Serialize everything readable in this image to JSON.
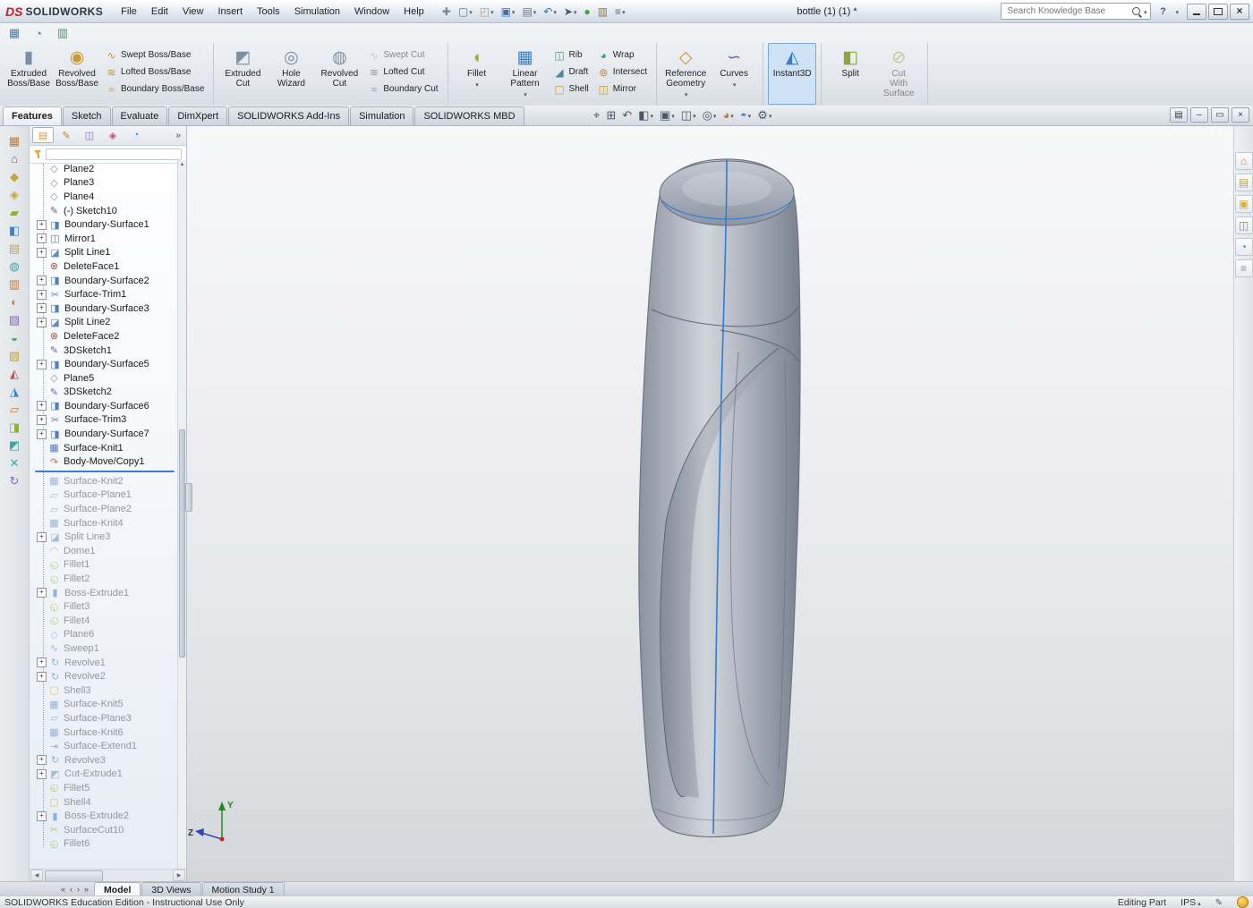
{
  "window": {
    "brand": "SOLIDWORKS",
    "brand_mark": "DS",
    "title": "bottle (1) (1) *",
    "search_placeholder": "Search Knowledge Base"
  },
  "accent": {
    "split_line_blue": "#2e7cd6",
    "rollback_blue": "#3a7bd5",
    "instant3d_highlight": "#cfe3f6"
  },
  "menubar": {
    "menus": [
      "File",
      "Edit",
      "View",
      "Insert",
      "Tools",
      "Simulation",
      "Window",
      "Help"
    ],
    "quick_tools": [
      {
        "name": "pin-button",
        "glyph": "✚",
        "color": "#7a8594"
      },
      {
        "name": "new-document-button",
        "glyph": "▢",
        "color": "#5a7a9a",
        "dropdown": true
      },
      {
        "name": "open-button",
        "glyph": "◰",
        "color": "#c8a23a",
        "dropdown": true
      },
      {
        "name": "save-button",
        "glyph": "▣",
        "color": "#3a6fb0",
        "dropdown": true
      },
      {
        "name": "print-button",
        "glyph": "▤",
        "color": "#6a7684",
        "dropdown": true
      },
      {
        "name": "undo-button",
        "glyph": "↶",
        "color": "#3a6fb0",
        "dropdown": true
      },
      {
        "name": "select-button",
        "glyph": "➤",
        "color": "#4a5560",
        "dropdown": true
      },
      {
        "name": "rebuild-button",
        "glyph": "●",
        "color": "#3aa04a"
      },
      {
        "name": "file-properties-button",
        "glyph": "▥",
        "color": "#8a7a4a"
      },
      {
        "name": "options-button",
        "glyph": "≡",
        "color": "#5a6672",
        "dropdown": true
      }
    ]
  },
  "ribbon": {
    "mini_tools": [
      {
        "name": "mini-tool-1",
        "glyph": "▦",
        "color": "#5a7a9a"
      },
      {
        "name": "mini-tool-2",
        "glyph": "◔",
        "color": "#3a86c8"
      },
      {
        "name": "mini-tool-3",
        "glyph": "▥",
        "color": "#5a8a6a"
      }
    ],
    "tabs": [
      {
        "label": "Features",
        "active": true
      },
      {
        "label": "Sketch"
      },
      {
        "label": "Evaluate"
      },
      {
        "label": "DimXpert"
      },
      {
        "label": "SOLIDWORKS Add-Ins"
      },
      {
        "label": "Simulation"
      },
      {
        "label": "SOLIDWORKS MBD"
      }
    ],
    "groups": [
      {
        "big": [
          {
            "name": "extruded-boss-base-button",
            "label": "Extruded\nBoss/Base",
            "glyph": "▮",
            "color": "#7d8fa5"
          },
          {
            "name": "revolved-boss-base-button",
            "label": "Revolved\nBoss/Base",
            "glyph": "◉",
            "color": "#c89a30"
          }
        ],
        "smallcols": [
          [
            {
              "name": "swept-boss-base-button",
              "label": "Swept Boss/Base",
              "glyph": "∿",
              "color": "#c89a30"
            },
            {
              "name": "lofted-boss-base-button",
              "label": "Lofted Boss/Base",
              "glyph": "≋",
              "color": "#c89a30"
            },
            {
              "name": "boundary-boss-base-button",
              "label": "Boundary Boss/Base",
              "glyph": "≈",
              "color": "#c89a30"
            }
          ]
        ]
      },
      {
        "big": [
          {
            "name": "extruded-cut-button",
            "label": "Extruded\nCut",
            "glyph": "◩",
            "color": "#7d8fa5"
          },
          {
            "name": "hole-wizard-button",
            "label": "Hole\nWizard",
            "glyph": "◎",
            "color": "#7d8fa5"
          },
          {
            "name": "revolved-cut-button",
            "label": "Revolved\nCut",
            "glyph": "◍",
            "color": "#7d8fa5"
          }
        ],
        "smallcols": [
          [
            {
              "name": "swept-cut-button",
              "label": "Swept Cut",
              "glyph": "∿",
              "color": "#9aa2ac",
              "disabled": true
            },
            {
              "name": "lofted-cut-button",
              "label": "Lofted Cut",
              "glyph": "≋",
              "color": "#8a96a4"
            },
            {
              "name": "boundary-cut-button",
              "label": "Boundary Cut",
              "glyph": "≈",
              "color": "#8a96a4"
            }
          ]
        ]
      },
      {
        "big": [
          {
            "name": "fillet-button",
            "label": "Fillet",
            "glyph": "◖",
            "color": "#9ab33a",
            "dropdown": true
          },
          {
            "name": "linear-pattern-button",
            "label": "Linear\nPattern",
            "glyph": "▦",
            "color": "#3a7fc0",
            "dropdown": true
          }
        ],
        "smallcols": [
          [
            {
              "name": "rib-button",
              "label": "Rib",
              "glyph": "◫",
              "color": "#4a9a6a"
            },
            {
              "name": "draft-button",
              "label": "Draft",
              "glyph": "◢",
              "color": "#4a8aa0"
            },
            {
              "name": "shell-button",
              "label": "Shell",
              "glyph": "▢",
              "color": "#c89a30"
            }
          ],
          [
            {
              "name": "wrap-button",
              "label": "Wrap",
              "glyph": "◕",
              "color": "#3a9a8a"
            },
            {
              "name": "intersect-button",
              "label": "Intersect",
              "glyph": "⊚",
              "color": "#c87a2a"
            },
            {
              "name": "mirror-button",
              "label": "Mirror",
              "glyph": "◫",
              "color": "#c89a30"
            }
          ]
        ]
      },
      {
        "big": [
          {
            "name": "reference-geometry-button",
            "label": "Reference\nGeometry",
            "glyph": "◇",
            "color": "#c89a30",
            "dropdown": true
          },
          {
            "name": "curves-button",
            "label": "Curves",
            "glyph": "∽",
            "color": "#7a5ab0",
            "dropdown": true
          }
        ]
      },
      {
        "big": [
          {
            "name": "instant3d-button",
            "label": "Instant3D",
            "glyph": "◭",
            "color": "#3a7fc0",
            "active": true
          }
        ]
      },
      {
        "big": [
          {
            "name": "split-button",
            "label": "Split",
            "glyph": "◧",
            "color": "#8aa832"
          },
          {
            "name": "cut-with-surface-button",
            "label": "Cut\nWith\nSurface",
            "glyph": "⊘",
            "color": "#8aa832",
            "disabled": true
          }
        ]
      }
    ]
  },
  "headsup": {
    "buttons": [
      {
        "name": "zoom-to-fit-button",
        "glyph": "⌖",
        "color": "#4a5868"
      },
      {
        "name": "zoom-to-area-button",
        "glyph": "⊞",
        "color": "#4a5868"
      },
      {
        "name": "previous-view-button",
        "glyph": "↶",
        "color": "#4a5868"
      },
      {
        "name": "section-view-button",
        "glyph": "◧",
        "color": "#4a5868",
        "dropdown": true
      },
      {
        "name": "view-orientation-button",
        "glyph": "▣",
        "color": "#4a5868",
        "dropdown": true
      },
      {
        "name": "display-style-button",
        "glyph": "◫",
        "color": "#4a5868",
        "dropdown": true
      },
      {
        "name": "hide-show-items-button",
        "glyph": "◎",
        "color": "#4a5868",
        "dropdown": true
      },
      {
        "name": "edit-appearance-button",
        "glyph": "◕",
        "color": "#c87a2a",
        "dropdown": true
      },
      {
        "name": "apply-scene-button",
        "glyph": "◓",
        "color": "#3a86c8",
        "dropdown": true
      },
      {
        "name": "view-settings-button",
        "glyph": "⚙",
        "color": "#4a5868",
        "dropdown": true
      }
    ]
  },
  "docwin_controls": [
    {
      "name": "doc-menu-button",
      "glyph": "▤"
    },
    {
      "name": "doc-minimize-button",
      "glyph": "–"
    },
    {
      "name": "doc-restore-button",
      "glyph": "▭"
    },
    {
      "name": "doc-close-button",
      "glyph": "×"
    }
  ],
  "side_toolbar": [
    {
      "name": "side-tool-1",
      "glyph": "▦",
      "color": "#c87a2a"
    },
    {
      "name": "side-tool-2",
      "glyph": "⌂",
      "color": "#b05030"
    },
    {
      "name": "side-tool-3",
      "glyph": "◆",
      "color": "#c8a23a"
    },
    {
      "name": "side-tool-4",
      "glyph": "◈",
      "color": "#c8a23a"
    },
    {
      "name": "side-tool-5",
      "glyph": "▰",
      "color": "#8fae3a"
    },
    {
      "name": "side-tool-6",
      "glyph": "◧",
      "color": "#3a86c8"
    },
    {
      "name": "side-tool-7",
      "glyph": "▤",
      "color": "#c8a23a"
    },
    {
      "name": "side-tool-8",
      "glyph": "◍",
      "color": "#3aa6a0"
    },
    {
      "name": "side-tool-9",
      "glyph": "▥",
      "color": "#c87a2a"
    },
    {
      "name": "side-tool-10",
      "glyph": "◐",
      "color": "#b08848"
    },
    {
      "name": "side-tool-11",
      "glyph": "▨",
      "color": "#8868b8"
    },
    {
      "name": "side-tool-12",
      "glyph": "◒",
      "color": "#4a9858"
    },
    {
      "name": "side-tool-13",
      "glyph": "▧",
      "color": "#c8a23a"
    },
    {
      "name": "side-tool-14",
      "glyph": "◭",
      "color": "#c85050"
    },
    {
      "name": "side-tool-15",
      "glyph": "◮",
      "color": "#3a86c8"
    },
    {
      "name": "side-tool-16",
      "glyph": "▱",
      "color": "#c87a2a"
    },
    {
      "name": "side-tool-17",
      "glyph": "◨",
      "color": "#8fae3a"
    },
    {
      "name": "side-tool-18",
      "glyph": "◩",
      "color": "#3aa6a0"
    },
    {
      "name": "side-tool-19",
      "glyph": "✕",
      "color": "#3aa6a0"
    },
    {
      "name": "side-tool-20",
      "glyph": "↻",
      "color": "#8868b8"
    }
  ],
  "tree": {
    "tabs": [
      {
        "name": "featuremanager-tab",
        "glyph": "▤",
        "color": "#c8a23a",
        "active": true
      },
      {
        "name": "propertymanager-tab",
        "glyph": "✎",
        "color": "#c87a2a"
      },
      {
        "name": "configurationmanager-tab",
        "glyph": "◫",
        "color": "#8868b8"
      },
      {
        "name": "dimxpertmanager-tab",
        "glyph": "◈",
        "color": "#c85078"
      },
      {
        "name": "displaymanager-tab",
        "glyph": "◔",
        "color": "#3a86c8"
      }
    ],
    "icon_types": {
      "plane": {
        "glyph": "◇",
        "color": "#6f9cc4"
      },
      "sketch": {
        "glyph": "✎",
        "color": "#5f6e80"
      },
      "sketch3d": {
        "glyph": "✎",
        "color": "#7a5ab0"
      },
      "boundary-surface": {
        "glyph": "◨",
        "color": "#4d7fbe"
      },
      "mirror": {
        "glyph": "◫",
        "color": "#4d7fbe"
      },
      "split-line": {
        "glyph": "◪",
        "color": "#5f8cc0"
      },
      "delete-face": {
        "glyph": "⊗",
        "color": "#b05050"
      },
      "surface-trim": {
        "glyph": "✂",
        "color": "#4d7fbe"
      },
      "surface-knit": {
        "glyph": "▦",
        "color": "#4d7fbe"
      },
      "body-move": {
        "glyph": "↷",
        "color": "#c07a2a"
      },
      "surface-plane": {
        "glyph": "▱",
        "color": "#4d7fbe"
      },
      "dome": {
        "glyph": "◠",
        "color": "#c07a2a"
      },
      "fillet": {
        "glyph": "◵",
        "color": "#8aa832"
      },
      "boss-extrude": {
        "glyph": "▮",
        "color": "#3f7fc0"
      },
      "sweep": {
        "glyph": "∿",
        "color": "#3f7fc0"
      },
      "revolve": {
        "glyph": "↻",
        "color": "#3f7fc0"
      },
      "shell": {
        "glyph": "▢",
        "color": "#c89a30"
      },
      "surface-extend": {
        "glyph": "⇥",
        "color": "#4d7fbe"
      },
      "cut-extrude": {
        "glyph": "◩",
        "color": "#7d8fa5"
      },
      "surface-cut": {
        "glyph": "✂",
        "color": "#8aa832"
      }
    },
    "items": [
      {
        "label": "Plane2",
        "type": "plane"
      },
      {
        "label": "Plane3",
        "type": "plane"
      },
      {
        "label": "Plane4",
        "type": "plane"
      },
      {
        "label": "(-) Sketch10",
        "type": "sketch"
      },
      {
        "label": "Boundary-Surface1",
        "type": "boundary-surface",
        "plus": true
      },
      {
        "label": "Mirror1",
        "type": "mirror",
        "plus": true
      },
      {
        "label": "Split Line1",
        "type": "split-line",
        "plus": true
      },
      {
        "label": "DeleteFace1",
        "type": "delete-face"
      },
      {
        "label": "Boundary-Surface2",
        "type": "boundary-surface",
        "plus": true
      },
      {
        "label": "Surface-Trim1",
        "type": "surface-trim",
        "plus": true
      },
      {
        "label": "Boundary-Surface3",
        "type": "boundary-surface",
        "plus": true
      },
      {
        "label": "Split Line2",
        "type": "split-line",
        "plus": true
      },
      {
        "label": "DeleteFace2",
        "type": "delete-face"
      },
      {
        "label": "3DSketch1",
        "type": "sketch3d"
      },
      {
        "label": "Boundary-Surface5",
        "type": "boundary-surface",
        "plus": true
      },
      {
        "label": "Plane5",
        "type": "plane"
      },
      {
        "label": "3DSketch2",
        "type": "sketch3d"
      },
      {
        "label": "Boundary-Surface6",
        "type": "boundary-surface",
        "plus": true
      },
      {
        "label": "Surface-Trim3",
        "type": "surface-trim",
        "plus": true
      },
      {
        "label": "Boundary-Surface7",
        "type": "boundary-surface",
        "plus": true
      },
      {
        "label": "Surface-Knit1",
        "type": "surface-knit"
      },
      {
        "label": "Body-Move/Copy1",
        "type": "body-move",
        "rollback_after": true
      },
      {
        "label": "Surface-Knit2",
        "type": "surface-knit",
        "grayed": true
      },
      {
        "label": "Surface-Plane1",
        "type": "surface-plane",
        "grayed": true
      },
      {
        "label": "Surface-Plane2",
        "type": "surface-plane",
        "grayed": true
      },
      {
        "label": "Surface-Knit4",
        "type": "surface-knit",
        "grayed": true
      },
      {
        "label": "Split Line3",
        "type": "split-line",
        "plus": true,
        "grayed": true
      },
      {
        "label": "Dome1",
        "type": "dome",
        "grayed": true
      },
      {
        "label": "Fillet1",
        "type": "fillet",
        "grayed": true
      },
      {
        "label": "Fillet2",
        "type": "fillet",
        "grayed": true
      },
      {
        "label": "Boss-Extrude1",
        "type": "boss-extrude",
        "plus": true,
        "grayed": true
      },
      {
        "label": "Fillet3",
        "type": "fillet",
        "grayed": true
      },
      {
        "label": "Fillet4",
        "type": "fillet",
        "grayed": true
      },
      {
        "label": "Plane6",
        "type": "plane",
        "grayed": true
      },
      {
        "label": "Sweep1",
        "type": "sweep",
        "grayed": true
      },
      {
        "label": "Revolve1",
        "type": "revolve",
        "plus": true,
        "grayed": true
      },
      {
        "label": "Revolve2",
        "type": "revolve",
        "plus": true,
        "grayed": true
      },
      {
        "label": "Shell3",
        "type": "shell",
        "grayed": true
      },
      {
        "label": "Surface-Knit5",
        "type": "surface-knit",
        "grayed": true
      },
      {
        "label": "Surface-Plane3",
        "type": "surface-plane",
        "grayed": true
      },
      {
        "label": "Surface-Knit6",
        "type": "surface-knit",
        "grayed": true
      },
      {
        "label": "Surface-Extend1",
        "type": "surface-extend",
        "grayed": true
      },
      {
        "label": "Revolve3",
        "type": "revolve",
        "plus": true,
        "grayed": true
      },
      {
        "label": "Cut-Extrude1",
        "type": "cut-extrude",
        "plus": true,
        "grayed": true
      },
      {
        "label": "Fillet5",
        "type": "fillet",
        "grayed": true
      },
      {
        "label": "Shell4",
        "type": "shell",
        "grayed": true
      },
      {
        "label": "Boss-Extrude2",
        "type": "boss-extrude",
        "plus": true,
        "grayed": true
      },
      {
        "label": "SurfaceCut10",
        "type": "surface-cut",
        "grayed": true
      },
      {
        "label": "Fillet6",
        "type": "fillet",
        "grayed": true
      }
    ]
  },
  "taskpane": [
    {
      "name": "resources-tab",
      "glyph": "⌂",
      "color": "#c87a2a"
    },
    {
      "name": "design-library-tab",
      "glyph": "▤",
      "color": "#c8a23a"
    },
    {
      "name": "file-explorer-tab",
      "glyph": "▣",
      "color": "#d8b23c"
    },
    {
      "name": "view-palette-tab",
      "glyph": "◫",
      "color": "#7a9c4a"
    },
    {
      "name": "appearances-tab",
      "glyph": "◔",
      "color": "#3a86c8"
    },
    {
      "name": "custom-properties-tab",
      "glyph": "≡",
      "color": "#8a94a0"
    }
  ],
  "doc_tabs": {
    "nav": [
      "«",
      "‹",
      "›",
      "»"
    ],
    "tabs": [
      {
        "label": "Model",
        "active": true
      },
      {
        "label": "3D Views"
      },
      {
        "label": "Motion Study 1"
      }
    ]
  },
  "statusbar": {
    "left": "SOLIDWORKS Education Edition - Instructional Use Only",
    "editing": "Editing Part",
    "units": "IPS"
  },
  "viewport": {
    "background_top": "#f7f8f9",
    "background_bottom": "#d3d6da",
    "model_gray": "#b9bfc8",
    "split_line_blue": "#2e7cd6",
    "triad": {
      "y_label": "Y",
      "z_label": "Z"
    }
  }
}
